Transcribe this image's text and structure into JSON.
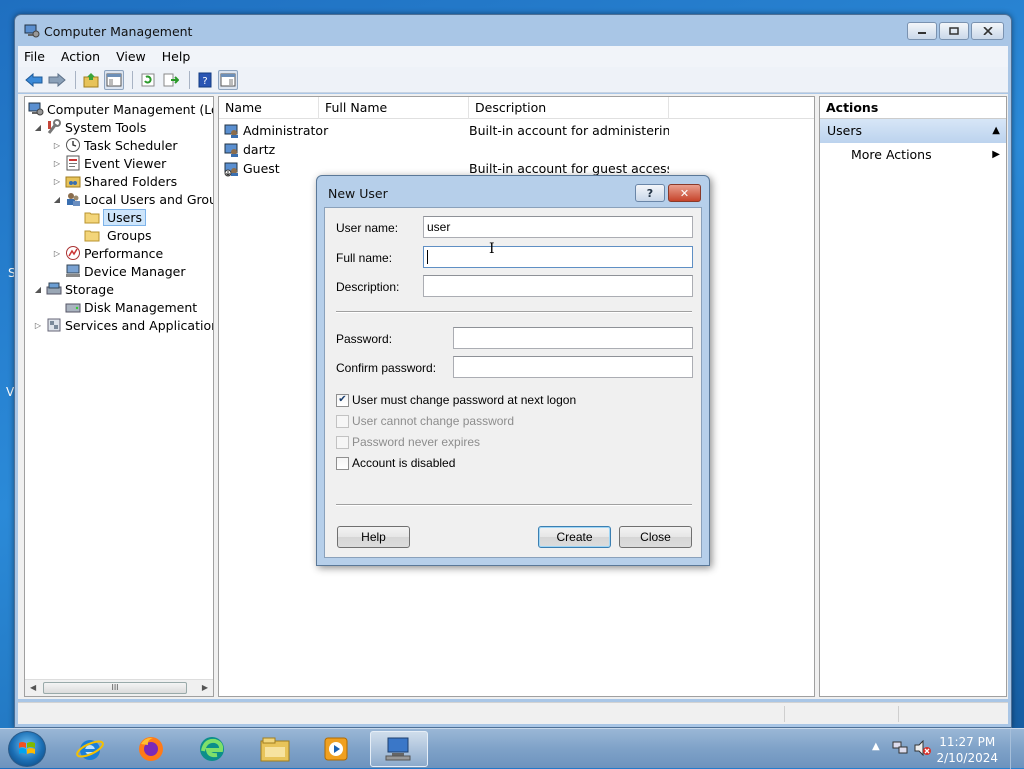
{
  "window": {
    "title": "Computer Management"
  },
  "menu": [
    "File",
    "Action",
    "View",
    "Help"
  ],
  "tree": {
    "root": "Computer Management (Local",
    "system_tools": "System Tools",
    "task_scheduler": "Task Scheduler",
    "event_viewer": "Event Viewer",
    "shared_folders": "Shared Folders",
    "local_users_groups": "Local Users and Groups",
    "users": "Users",
    "groups": "Groups",
    "performance": "Performance",
    "device_manager": "Device Manager",
    "storage": "Storage",
    "disk_management": "Disk Management",
    "services_apps": "Services and Applications",
    "scroll_thumb": "III"
  },
  "list": {
    "columns": [
      "Name",
      "Full Name",
      "Description"
    ],
    "rows": [
      {
        "name": "Administrator",
        "full_name": "",
        "description": "Built-in account for administering..."
      },
      {
        "name": "dartz",
        "full_name": "",
        "description": ""
      },
      {
        "name": "Guest",
        "full_name": "",
        "description": "Built-in account for guest access t..."
      }
    ]
  },
  "actions": {
    "title": "Actions",
    "section": "Users",
    "more_actions": "More Actions"
  },
  "dialog": {
    "title": "New User",
    "help_glyph": "?",
    "close_glyph": "✕",
    "username_label": "User name:",
    "username_value": "user",
    "fullname_label": "Full name:",
    "fullname_value": "",
    "description_label": "Description:",
    "description_value": "",
    "password_label": "Password:",
    "confirm_label": "Confirm password:",
    "checkboxes": [
      {
        "label": "User must change password at next logon",
        "checked": true,
        "enabled": true
      },
      {
        "label": "User cannot change password",
        "checked": false,
        "enabled": false
      },
      {
        "label": "Password never expires",
        "checked": false,
        "enabled": false
      },
      {
        "label": "Account is disabled",
        "checked": false,
        "enabled": true
      }
    ],
    "help_button": "Help",
    "create_button": "Create",
    "close_button": "Close"
  },
  "taskbar": {
    "time": "11:27 PM",
    "date": "2/10/2024"
  },
  "desktop_fragments": [
    "S",
    "V"
  ]
}
